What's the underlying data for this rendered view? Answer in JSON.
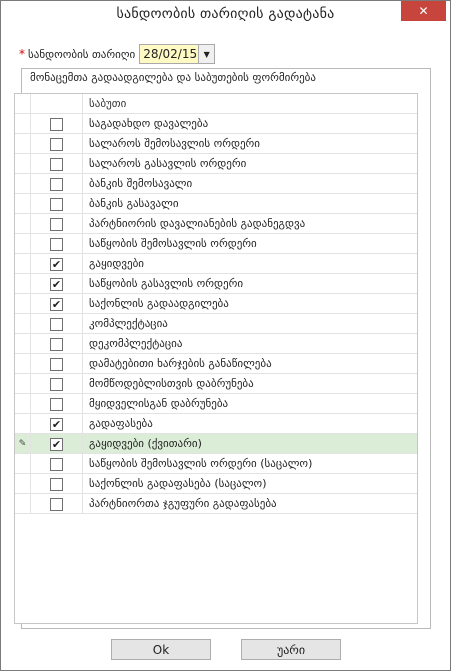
{
  "window": {
    "title": "სანდოობის თარიღის გადატანა",
    "close_glyph": "✕"
  },
  "date_field": {
    "required_mark": "*",
    "label": "სანდოობის თარიღი",
    "value": "28/02/15"
  },
  "group": {
    "title": "მონაცემთა გადაადგილება და საბუთების ფორმირება"
  },
  "table": {
    "header": "საბუთი",
    "rows": [
      {
        "label": "საგადახდო დავალება",
        "checked": false
      },
      {
        "label": "სალაროს შემოსავლის ორდერი",
        "checked": false
      },
      {
        "label": "სალაროს გასავლის ორდერი",
        "checked": false
      },
      {
        "label": "ბანკის შემოსავალი",
        "checked": false
      },
      {
        "label": "ბანკის გასავალი",
        "checked": false
      },
      {
        "label": "პარტნიორის დავალიანების გადანეგდვა",
        "checked": false
      },
      {
        "label": "საწყობის შემოსავლის ორდერი",
        "checked": false
      },
      {
        "label": "გაყიდვები",
        "checked": true
      },
      {
        "label": "საწყობის გასავლის ორდერი",
        "checked": true
      },
      {
        "label": "საქონლის გადაადგილება",
        "checked": true
      },
      {
        "label": "კომპლექტაცია",
        "checked": false
      },
      {
        "label": "დეკომპლექტაცია",
        "checked": false
      },
      {
        "label": "დამატებითი ხარჯების განაწილება",
        "checked": false
      },
      {
        "label": "მომწოდებლისთვის დაბრუნება",
        "checked": false
      },
      {
        "label": "მყიდველისგან დაბრუნება",
        "checked": false
      },
      {
        "label": "გადაფასება",
        "checked": true
      },
      {
        "label": "გაყიდვები (ქვითარი)",
        "checked": true,
        "selected": true,
        "indicator": "✎"
      },
      {
        "label": "საწყობის შემოსავლის ორდერი (საცალო)",
        "checked": false
      },
      {
        "label": "საქონლის გადაფასება (საცალო)",
        "checked": false
      },
      {
        "label": "პარტნიორთა ჯგუფური გადაფასება",
        "checked": false
      }
    ]
  },
  "buttons": {
    "ok": "Ok",
    "cancel": "უარი"
  },
  "colors": {
    "close_bg": "#c7453c",
    "date_bg": "#fff9c4",
    "selected_row_bg": "#dcedd7"
  }
}
